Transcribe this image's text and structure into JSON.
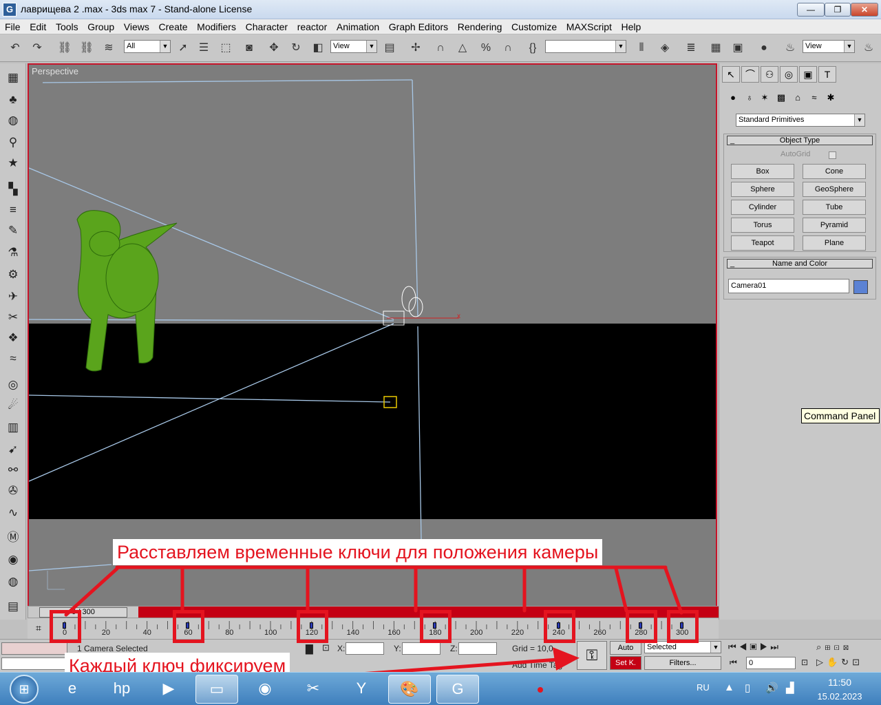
{
  "window": {
    "title": "лаврищева 2 .max - 3ds max 7  - Stand-alone License",
    "minimize": "—",
    "maximize": "❐",
    "close": "✕"
  },
  "menu": [
    "File",
    "Edit",
    "Tools",
    "Group",
    "Views",
    "Create",
    "Modifiers",
    "Character",
    "reactor",
    "Animation",
    "Graph Editors",
    "Rendering",
    "Customize",
    "MAXScript",
    "Help"
  ],
  "toolbar": {
    "selection_filter": "All",
    "ref_coord": "View",
    "named_selection": "",
    "render_view": "View"
  },
  "viewport": {
    "label": "Perspective"
  },
  "command_panel": {
    "category_dropdown": "Standard Primitives",
    "object_type_title": "Object Type",
    "autogrid_label": "AutoGrid",
    "primitives": [
      "Box",
      "Cone",
      "Sphere",
      "GeoSphere",
      "Cylinder",
      "Tube",
      "Torus",
      "Pyramid",
      "Teapot",
      "Plane"
    ],
    "name_color_title": "Name and Color",
    "object_name": "Camera01",
    "object_color": "#5b82d4",
    "tooltip": "Command Panel"
  },
  "time_slider": {
    "frame_label": "0 / 300"
  },
  "trackbar": {
    "ticks": [
      "0",
      "20",
      "40",
      "60",
      "80",
      "100",
      "120",
      "140",
      "160",
      "180",
      "200",
      "220",
      "240",
      "260",
      "280",
      "300"
    ],
    "keyframes": [
      0,
      60,
      120,
      180,
      240,
      280,
      300
    ]
  },
  "status": {
    "selection_info": "1 Camera Selected",
    "x_label": "X:",
    "y_label": "Y:",
    "z_label": "Z:",
    "x_value": "",
    "y_value": "",
    "z_value": "",
    "grid": "Grid = 10,0",
    "add_time_tag": "Add Time Tag",
    "auto_key": "Auto",
    "set_key": "Set K.",
    "key_mode": "Selected",
    "filters": "Filters...",
    "current_frame": "0"
  },
  "annotations": {
    "top_caption": "Расставляем временные ключи для положения камеры",
    "bottom_caption": "Каждый ключ фиксируем",
    "color": "#e4141f"
  },
  "taskbar": {
    "language": "RU",
    "time": "11:50",
    "date": "15.02.2023"
  }
}
